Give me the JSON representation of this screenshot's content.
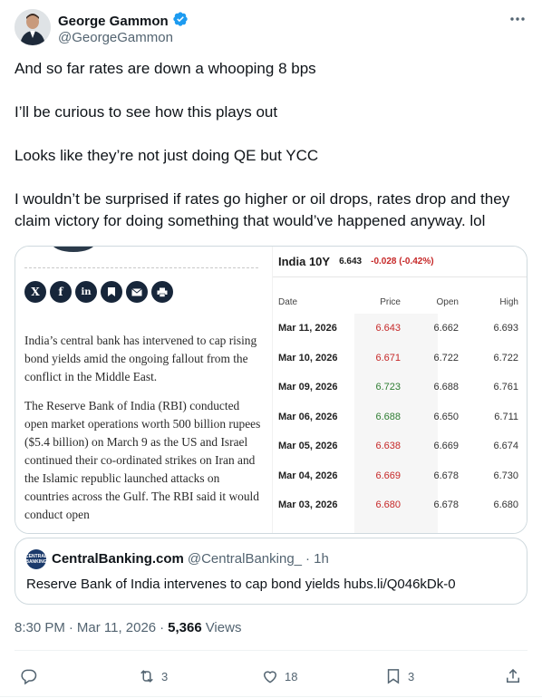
{
  "author": {
    "name": "George Gammon",
    "handle": "@GeorgeGammon",
    "verified": true,
    "avatar_icon": "profile-photo"
  },
  "tweet": {
    "paragraphs": [
      "And so far rates are down a whooping 8 bps",
      "I’ll be curious to see how this plays out",
      "Looks like they’re not just doing QE but YCC",
      "I wouldn’t be surprised if rates go higher or oil drops, rates drop and they claim victory for doing something that would’ve happened anyway. lol"
    ]
  },
  "media": {
    "share_icons": [
      "x-icon",
      "facebook-icon",
      "linkedin-icon",
      "bookmark-icon",
      "email-icon",
      "print-icon"
    ],
    "article_paragraphs": [
      "India’s central bank has intervened to cap rising bond yields amid the ongoing fallout from the conflict in the Middle East.",
      "The Reserve Bank of India (RBI) conducted open market operations worth 500 billion rupees ($5.4 billion) on March 9 as the US and Israel continued their co-ordinated strikes on Iran and the Islamic republic launched attacks on countries across the Gulf. The RBI said it would conduct open"
    ],
    "table": {
      "title": "India 10Y",
      "last_price": "6.643",
      "change": "-0.028",
      "change_pct": "(-0.42%)",
      "columns": [
        "Date",
        "Price",
        "Open",
        "High"
      ],
      "rows": [
        {
          "date": "Mar 11, 2026",
          "price": "6.643",
          "open": "6.662",
          "high": "6.693",
          "dir": "down"
        },
        {
          "date": "Mar 10, 2026",
          "price": "6.671",
          "open": "6.722",
          "high": "6.722",
          "dir": "down"
        },
        {
          "date": "Mar 09, 2026",
          "price": "6.723",
          "open": "6.688",
          "high": "6.761",
          "dir": "up"
        },
        {
          "date": "Mar 06, 2026",
          "price": "6.688",
          "open": "6.650",
          "high": "6.711",
          "dir": "up"
        },
        {
          "date": "Mar 05, 2026",
          "price": "6.638",
          "open": "6.669",
          "high": "6.674",
          "dir": "down"
        },
        {
          "date": "Mar 04, 2026",
          "price": "6.669",
          "open": "6.678",
          "high": "6.730",
          "dir": "down"
        },
        {
          "date": "Mar 03, 2026",
          "price": "6.680",
          "open": "6.678",
          "high": "6.680",
          "dir": "down"
        }
      ],
      "colors": {
        "down": "#c62828",
        "up": "#2e7d32"
      }
    }
  },
  "quote": {
    "avatar_label": "CENTRAL BANKING",
    "name": "CentralBanking.com",
    "handle": "@CentralBanking_",
    "time": "· 1h",
    "text": "Reserve Bank of India intervenes to cap bond yields hubs.li/Q046kDk-0"
  },
  "meta": {
    "time": "8:30 PM",
    "date": "Mar 11, 2026",
    "sep": "·",
    "views_count": "5,366",
    "views_label": "Views"
  },
  "actions": {
    "replies": "",
    "reposts": "3",
    "likes": "18",
    "bookmarks": "3"
  },
  "colors": {
    "text": "#0f1419",
    "secondary": "#536471",
    "verified": "#1d9bf0",
    "border": "#cfd9de"
  }
}
